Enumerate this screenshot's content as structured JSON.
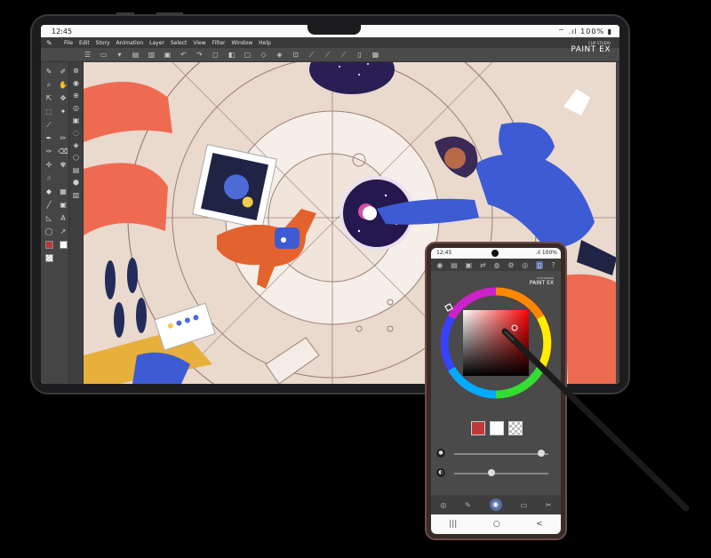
{
  "tablet": {
    "status": {
      "time": "12:45",
      "indicators": "⌔ .ıl 100% ▮"
    },
    "menu": [
      "File",
      "Edit",
      "Story",
      "Animation",
      "Layer",
      "Select",
      "View",
      "Filter",
      "Window",
      "Help"
    ],
    "brand": {
      "sub": "CLIP STUDIO",
      "main": "PAINT EX"
    }
  },
  "phone": {
    "status": {
      "time": "12:45",
      "indicators": ".ıl 100%"
    },
    "brand": {
      "sub": "CLIP STUDIO",
      "main": "PAINT EX"
    },
    "slider_value": 0.92,
    "slider_opacity": 0.4,
    "colors": {
      "main": "#c0393b",
      "sub": "#ffffff",
      "transparent": "checker"
    },
    "nav": [
      "|||",
      "○",
      "<"
    ]
  },
  "icons": {
    "menu_logo": "clip-studio-logo-icon",
    "pen": "pen-icon",
    "eye": "eye-icon"
  }
}
